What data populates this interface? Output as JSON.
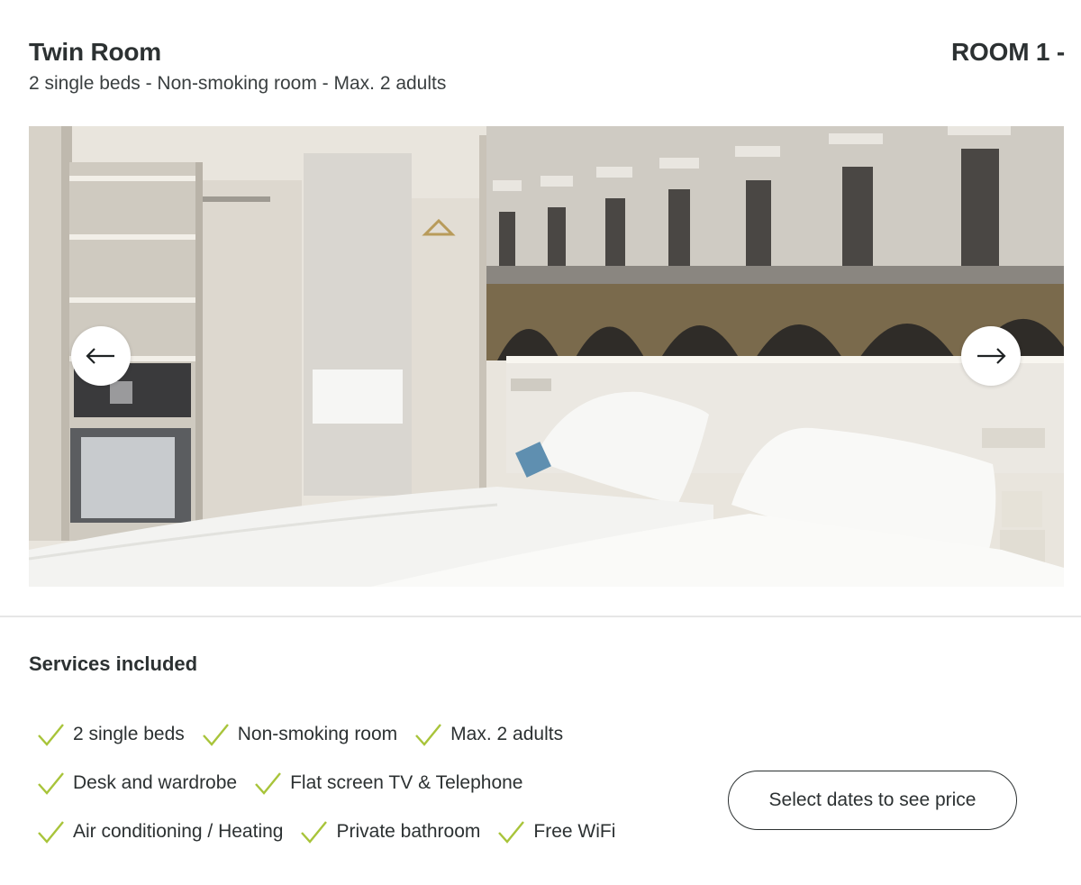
{
  "room": {
    "title": "Twin Room",
    "index_label": "ROOM 1 -",
    "subtitle": "2 single beds - Non-smoking room - Max. 2 adults"
  },
  "gallery": {
    "prev_icon": "arrow-left-icon",
    "next_icon": "arrow-right-icon"
  },
  "services": {
    "title": "Services included",
    "check_icon": "check-icon",
    "check_color": "#a8c43a",
    "rows": [
      [
        "2 single beds",
        "Non-smoking room",
        "Max. 2 adults"
      ],
      [
        "Desk and wardrobe",
        "Flat screen TV & Telephone"
      ],
      [
        "Air conditioning / Heating",
        "Private bathroom",
        "Free WiFi"
      ]
    ]
  },
  "cta": {
    "label": "Select dates to see price"
  }
}
